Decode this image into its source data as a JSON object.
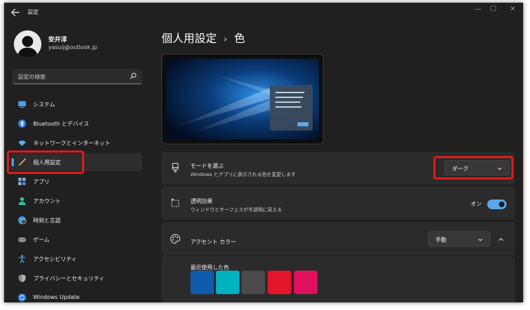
{
  "window": {
    "title": "設定",
    "controls": [
      "—",
      "☐",
      "✕"
    ]
  },
  "profile": {
    "name": "安井淳",
    "email": "yasuij@outlook.jp"
  },
  "search": {
    "placeholder": "設定の検索"
  },
  "sidebar": {
    "items": [
      {
        "label": "システム",
        "icon": "monitor-icon"
      },
      {
        "label": "Bluetooth とデバイス",
        "icon": "bluetooth-icon"
      },
      {
        "label": "ネットワークとインターネット",
        "icon": "wifi-icon"
      },
      {
        "label": "個人用設定",
        "icon": "brush-icon",
        "selected": true
      },
      {
        "label": "アプリ",
        "icon": "apps-icon"
      },
      {
        "label": "アカウント",
        "icon": "person-icon"
      },
      {
        "label": "時刻と言語",
        "icon": "clock-globe-icon"
      },
      {
        "label": "ゲーム",
        "icon": "gamepad-icon"
      },
      {
        "label": "アクセシビリティ",
        "icon": "accessibility-icon"
      },
      {
        "label": "プライバシーとセキュリティ",
        "icon": "shield-icon"
      },
      {
        "label": "Windows Update",
        "icon": "update-icon"
      }
    ]
  },
  "breadcrumb": {
    "parent": "個人用設定",
    "separator": "›",
    "current": "色"
  },
  "mode": {
    "title": "モードを選ぶ",
    "subtitle": "Windows とアプリに表示される色を変更します",
    "value": "ダーク"
  },
  "transparency": {
    "title": "透明効果",
    "subtitle": "ウィンドウとサーフェスが半透明に見える",
    "state": "オン"
  },
  "accent": {
    "title": "アクセント カラー",
    "value": "手動",
    "recent_label": "最近使用した色",
    "recent_colors": [
      "#0f5cae",
      "#00b2c0",
      "#4a4a4a",
      "#e3162b",
      "#e0105f"
    ]
  },
  "colors": {
    "accent": "#5aa8ea",
    "highlight_box": "#e41a1a"
  }
}
